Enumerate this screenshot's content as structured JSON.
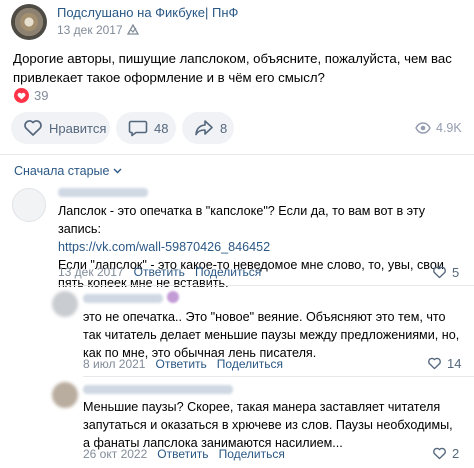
{
  "post": {
    "group_name": "Подслушано на Фикбуке| ПнФ",
    "date": "13 дек 2017",
    "text": "Дорогие авторы, пишущие лапслоком, объясните, пожалуйста, чем вас привлекает такое оформление и в чём его смысл?",
    "reactions_count": "39",
    "like_label": "Нравится",
    "comments_count": "48",
    "shares_count": "8",
    "views": "4.9K"
  },
  "sort_label": "Сначала старые",
  "comments": [
    {
      "text_before": "Лапслок - это опечатка в \"капслоке\"? Если да, то вам вот в эту запись:",
      "link": "https://vk.com/wall-59870426_846452",
      "text_after": "Если \"лапслок\" - это какое-то неведомое мне слово, то, увы, свои пять копеек мне не вставить.",
      "date": "13 дек 2017",
      "reply_label": "Ответить",
      "edit_label": "Поделиться",
      "likes": "5"
    },
    {
      "text": "это не опечатка.. Это \"новое\" веяние. Объясняют это тем, что так читатель делает меньшие паузы между предложениями, но, как по мне, это обычная лень писателя.",
      "date": "8 июл 2021",
      "reply_label": "Ответить",
      "edit_label": "Поделиться",
      "likes": "14"
    },
    {
      "text": "Меньшие паузы? Скорее, такая манера заставляет читателя запутаться и оказаться в хрючеве из слов. Паузы необходимы, а фанаты лапслока занимаются насилием...",
      "date": "26 окт 2022",
      "reply_label": "Ответить",
      "edit_label": "Поделиться",
      "likes": "2"
    }
  ],
  "colors": {
    "link": "#2a5885",
    "meta": "#818c99",
    "reaction": "#ff3347",
    "pill": "#f0f2f5"
  },
  "icons": [
    "verified-icon",
    "heart-icon",
    "comment-icon",
    "share-icon",
    "eye-icon",
    "chevron-down-icon"
  ]
}
